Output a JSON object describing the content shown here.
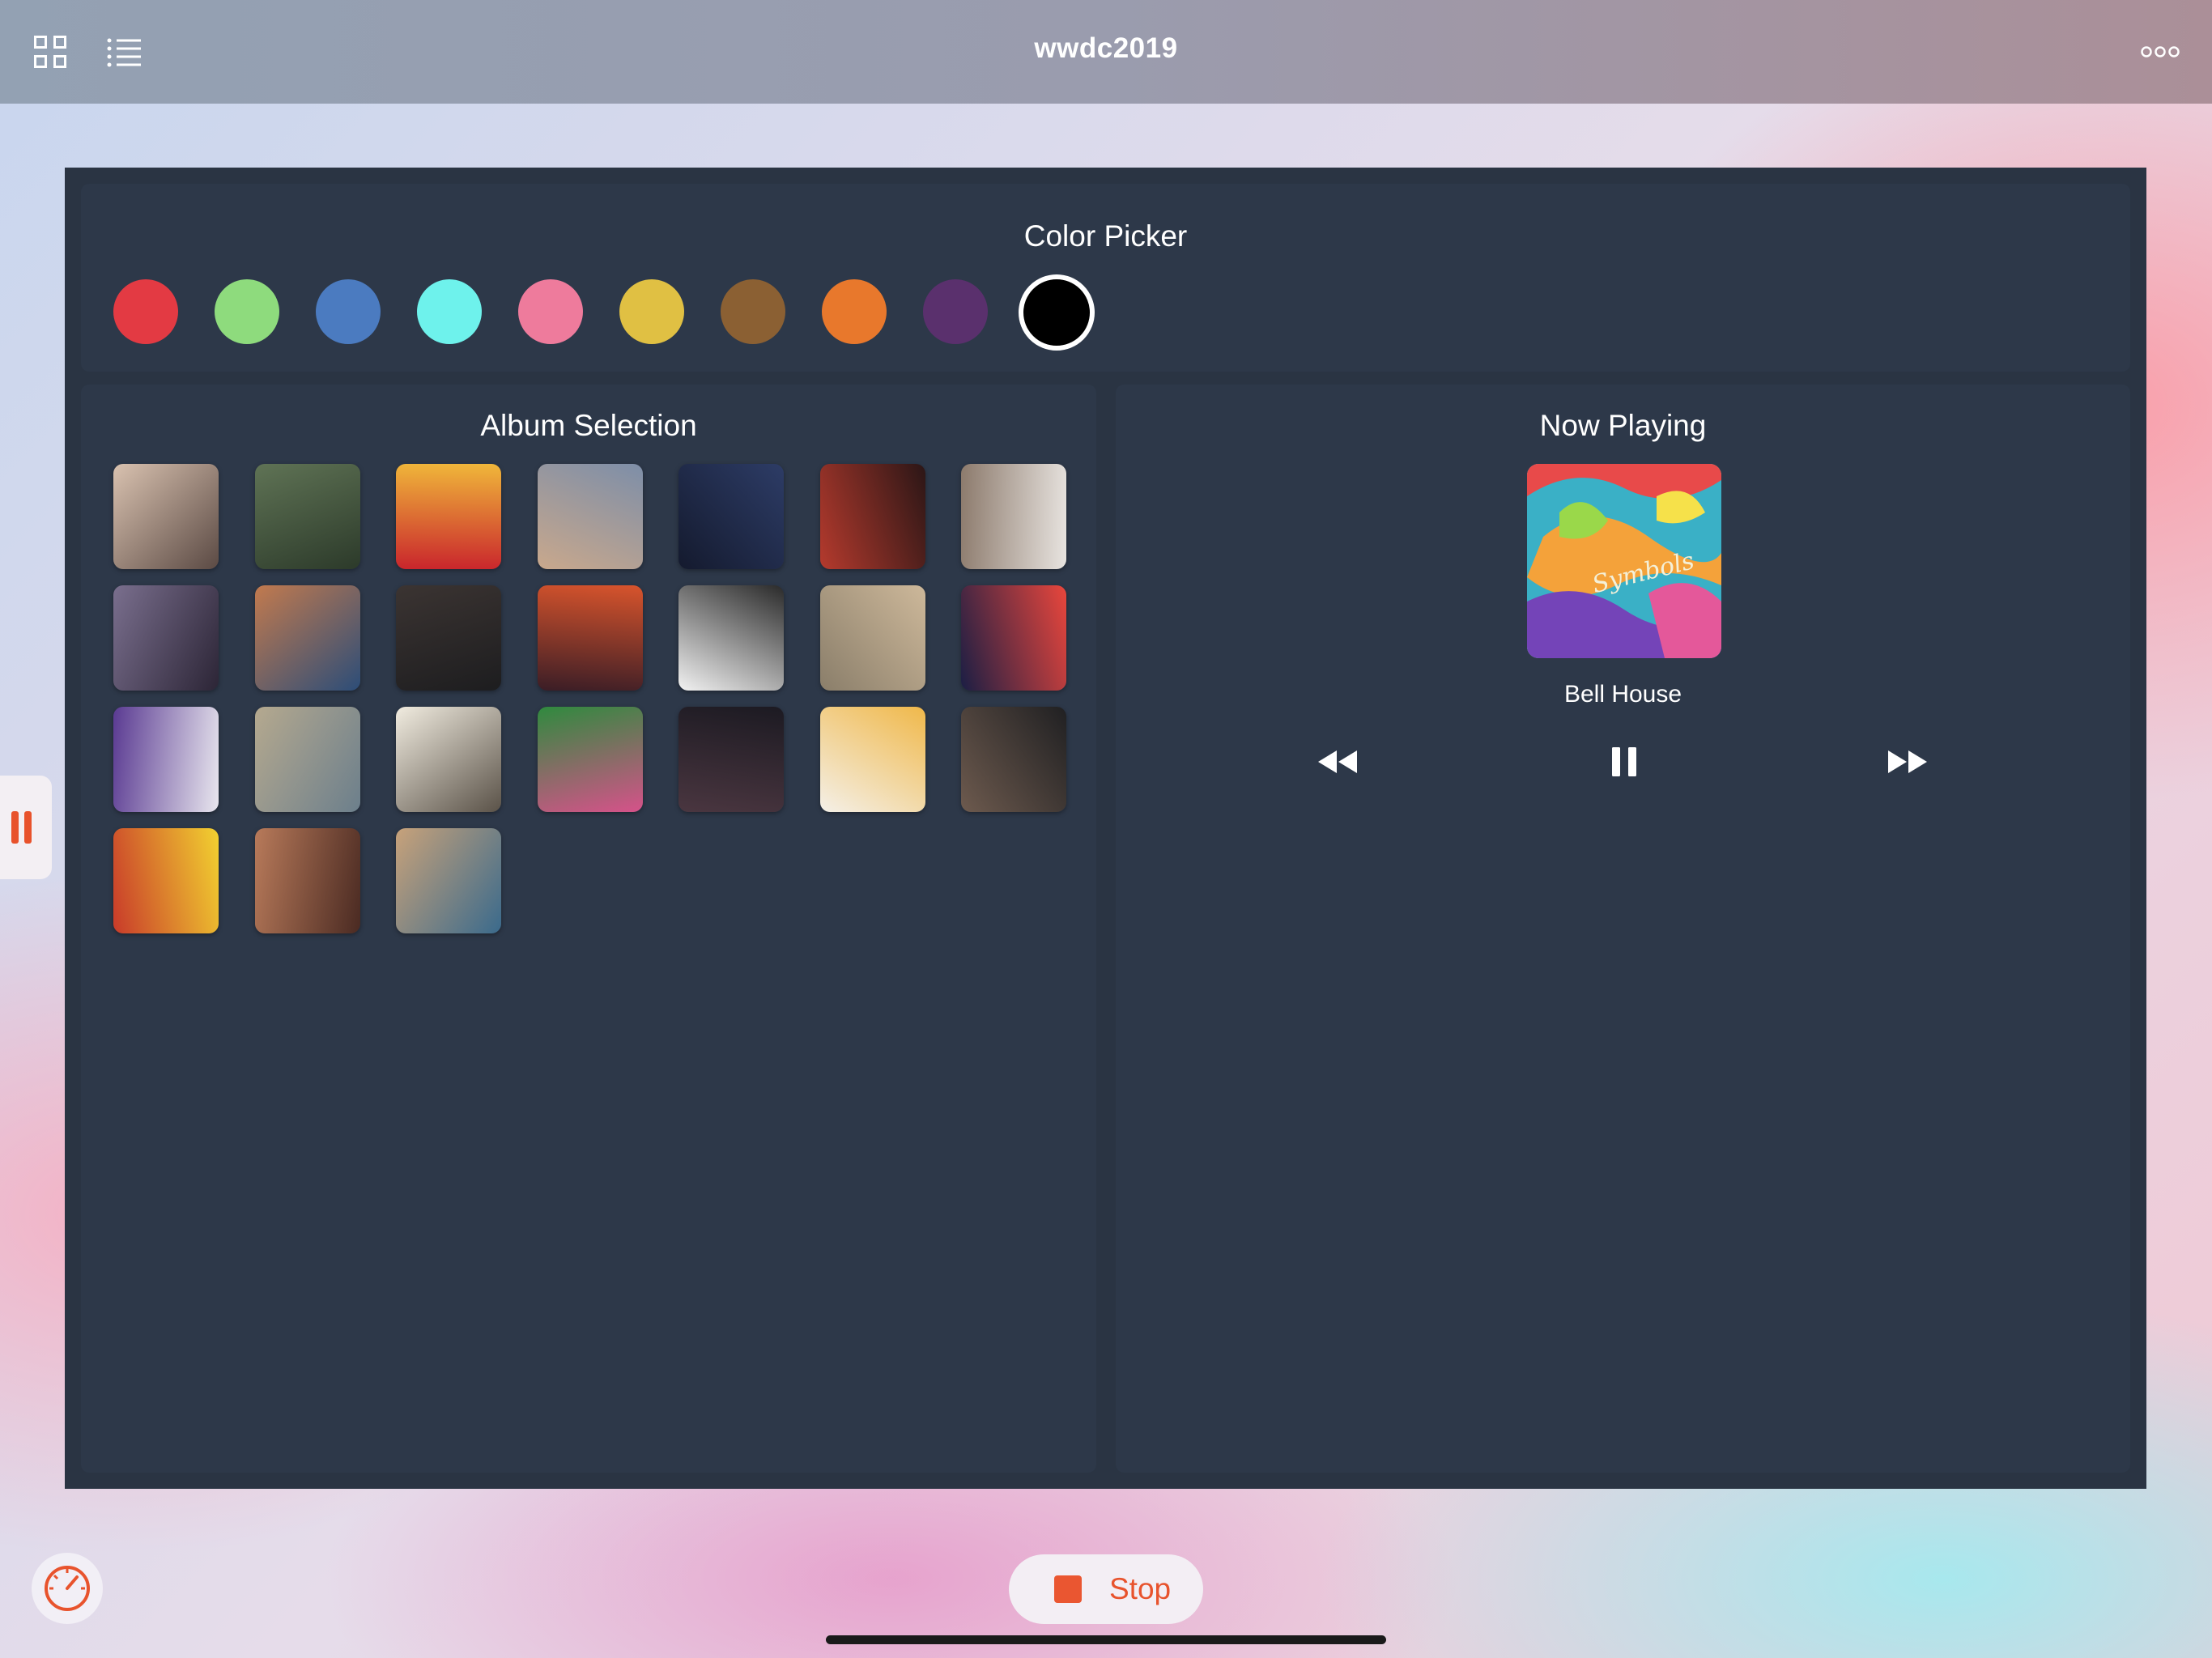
{
  "app": {
    "title": "wwdc2019",
    "icons": {
      "left": [
        "grid-view-icon",
        "list-view-icon"
      ],
      "right": "more-options-icon"
    }
  },
  "color_picker": {
    "title": "Color Picker",
    "colors": [
      {
        "name": "red",
        "hex": "#e33a43",
        "selected": false
      },
      {
        "name": "green",
        "hex": "#8edb7d",
        "selected": false
      },
      {
        "name": "blue",
        "hex": "#4b7bc0",
        "selected": false
      },
      {
        "name": "cyan",
        "hex": "#6ef2ec",
        "selected": false
      },
      {
        "name": "pink",
        "hex": "#ee7b9c",
        "selected": false
      },
      {
        "name": "yellow",
        "hex": "#e0c043",
        "selected": false
      },
      {
        "name": "brown",
        "hex": "#8b6033",
        "selected": false
      },
      {
        "name": "orange",
        "hex": "#e8782c",
        "selected": false
      },
      {
        "name": "purple",
        "hex": "#5a306d",
        "selected": false
      },
      {
        "name": "black",
        "hex": "#000000",
        "selected": true
      }
    ]
  },
  "album_selection": {
    "title": "Album Selection",
    "albums": [
      {
        "colors": [
          "#d9c2b0",
          "#5b4a44"
        ]
      },
      {
        "colors": [
          "#5f7355",
          "#2c3a2a"
        ]
      },
      {
        "colors": [
          "#f0b73a",
          "#c9252c"
        ]
      },
      {
        "colors": [
          "#7d8ea8",
          "#c9a88c"
        ]
      },
      {
        "colors": [
          "#2d3c66",
          "#141a2e"
        ]
      },
      {
        "colors": [
          "#2b1616",
          "#b53a2d"
        ]
      },
      {
        "colors": [
          "#e8e4e0",
          "#8c7a6c"
        ]
      },
      {
        "colors": [
          "#2c2536",
          "#7a6f8e"
        ]
      },
      {
        "colors": [
          "#2c4d78",
          "#c27a4e"
        ]
      },
      {
        "colors": [
          "#1d1d1f",
          "#3b3432"
        ]
      },
      {
        "colors": [
          "#3a1d26",
          "#d8542c"
        ]
      },
      {
        "colors": [
          "#f2f2f2",
          "#2a2a2a"
        ]
      },
      {
        "colors": [
          "#8a7e6a",
          "#cdb89a"
        ]
      },
      {
        "colors": [
          "#1b1e44",
          "#e9463c"
        ]
      },
      {
        "colors": [
          "#5a3a92",
          "#e8e6ee"
        ]
      },
      {
        "colors": [
          "#b5a98f",
          "#6c7f8c"
        ]
      },
      {
        "colors": [
          "#f1ece0",
          "#5a5248"
        ]
      },
      {
        "colors": [
          "#2f8a3e",
          "#d6528a"
        ]
      },
      {
        "colors": [
          "#1c1a22",
          "#4a3640"
        ]
      },
      {
        "colors": [
          "#f0b84a",
          "#f4f0e8"
        ]
      },
      {
        "colors": [
          "#202022",
          "#6d5a4e"
        ]
      },
      {
        "colors": [
          "#f2d130",
          "#c83a2a"
        ]
      },
      {
        "colors": [
          "#4a2a22",
          "#b87a5a"
        ]
      },
      {
        "colors": [
          "#3a6a8c",
          "#c8a27a"
        ]
      }
    ]
  },
  "now_playing": {
    "title": "Now Playing",
    "track": "Bell House",
    "controls": [
      "rewind-icon",
      "pause-icon",
      "fast-forward-icon"
    ]
  },
  "bottom": {
    "gauge_icon": "speedometer-icon",
    "stop_label": "Stop",
    "stop_color": "#ea5631"
  }
}
